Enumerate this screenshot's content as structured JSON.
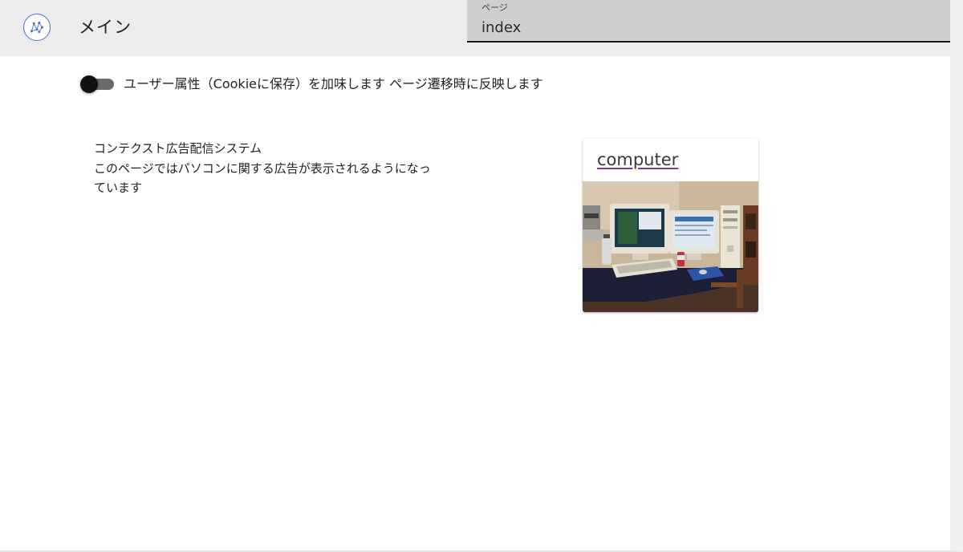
{
  "header": {
    "title": "メイン",
    "logo_icon": "network-graph-icon",
    "page_field": {
      "label": "ページ",
      "value": "index"
    }
  },
  "options": {
    "user_attribute_toggle": {
      "label": "ユーザー属性（Cookieに保存）を加味します ページ遷移時に反映します",
      "checked": false
    }
  },
  "content": {
    "heading": "コンテクスト広告配信システム",
    "description_lines": [
      "このページではパソコンに関する広告が表示されるようになっ",
      "ています"
    ]
  },
  "ad": {
    "link_text": "computer",
    "image_subject": "desk-with-two-computer-monitors-photo"
  },
  "colors": {
    "header_bg": "#ececec",
    "field_bg": "#cfcfcf",
    "logo_accent": "#4a72c4",
    "link_underline": "#7b3aa0"
  }
}
